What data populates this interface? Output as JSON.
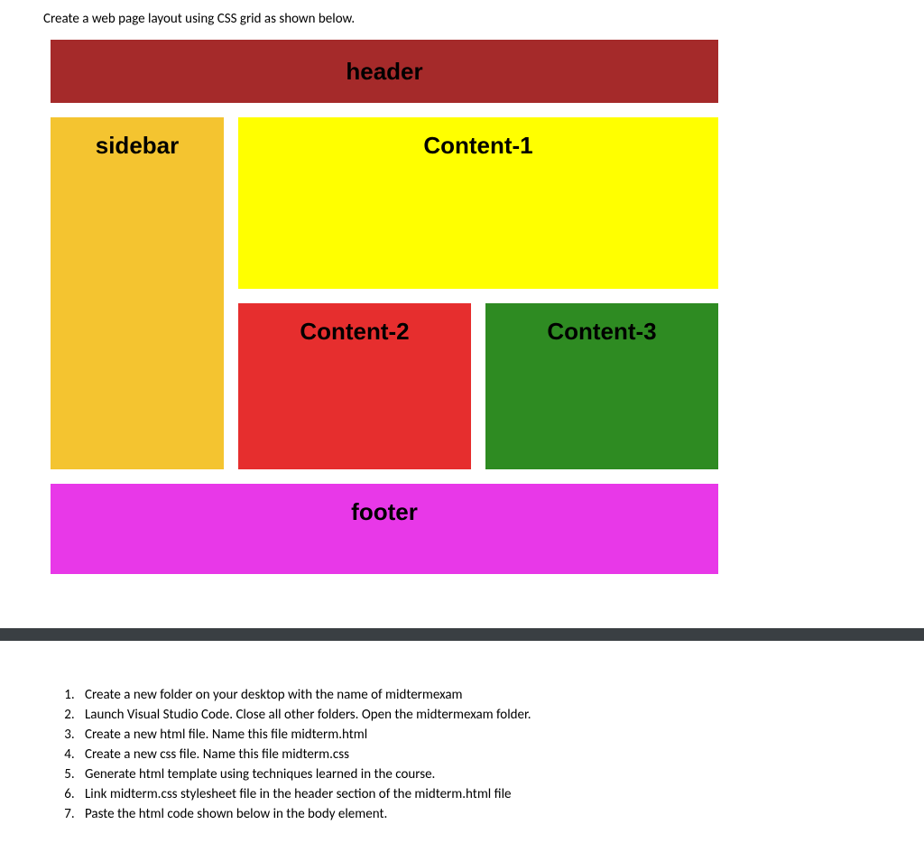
{
  "intro": "Create a web page layout using CSS grid as shown below.",
  "grid": {
    "header": "header",
    "sidebar": "sidebar",
    "content1": "Content-1",
    "content2": "Content-2",
    "content3": "Content-3",
    "footer": "footer"
  },
  "steps": [
    "Create a new folder on your desktop with the name of midtermexam",
    "Launch Visual Studio Code.  Close all other folders.  Open the midtermexam folder.",
    "Create a new html file. Name this file midterm.html",
    "Create a new css file. Name this file midterm.css",
    " Generate html template using techniques learned in the course.",
    "Link midterm.css stylesheet file in the header section of the midterm.html file",
    " Paste the html code shown below in the body element."
  ]
}
